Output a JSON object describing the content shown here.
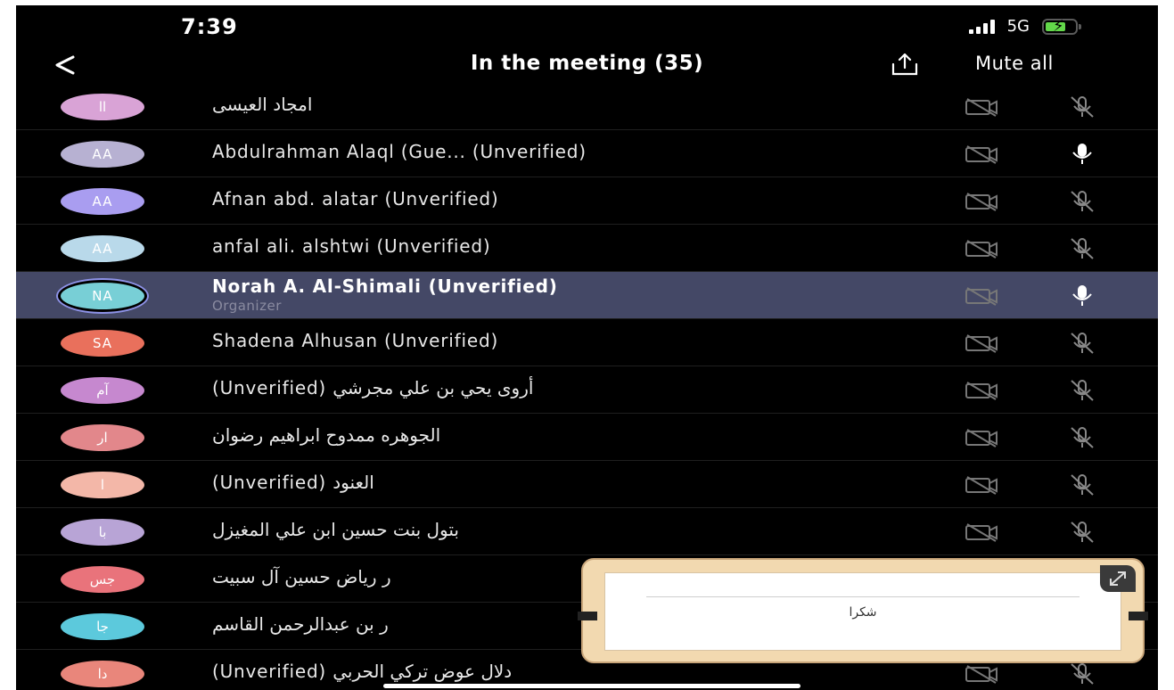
{
  "status": {
    "time": "7:39",
    "network": "5G"
  },
  "header": {
    "title": "In the meeting (35)",
    "mute_all": "Mute all"
  },
  "participants": [
    {
      "initials": "اا",
      "name": "امجاد العيسى",
      "role": "",
      "color": "#d9a3d6",
      "mic": "muted",
      "selected": false
    },
    {
      "initials": "AA",
      "name": "Abdulrahman Alaql (Gue... (Unverified)",
      "role": "",
      "color": "#b7b1d2",
      "mic": "on",
      "selected": false
    },
    {
      "initials": "AA",
      "name": "Afnan abd. alatar (Unverified)",
      "role": "",
      "color": "#a99df0",
      "mic": "muted",
      "selected": false
    },
    {
      "initials": "AA",
      "name": "anfal ali. alshtwi (Unverified)",
      "role": "",
      "color": "#b9d9ea",
      "mic": "muted",
      "selected": false
    },
    {
      "initials": "NA",
      "name": "Norah A. Al-Shimali (Unverified)",
      "role": "Organizer",
      "color": "#78cfd6",
      "mic": "on",
      "selected": true
    },
    {
      "initials": "SA",
      "name": "Shadena Alhusan (Unverified)",
      "role": "",
      "color": "#e9705c",
      "mic": "muted",
      "selected": false
    },
    {
      "initials": "آم",
      "name": "(Unverified) أروى يحي بن علي مجرشي",
      "role": "",
      "color": "#c688cf",
      "mic": "muted",
      "selected": false
    },
    {
      "initials": "ار",
      "name": "الجوهره ممدوح ابراهيم رضوان",
      "role": "",
      "color": "#e2878b",
      "mic": "muted",
      "selected": false
    },
    {
      "initials": "ا",
      "name": "(Unverified) العنود",
      "role": "",
      "color": "#f3b7a8",
      "mic": "muted",
      "selected": false
    },
    {
      "initials": "با",
      "name": "بتول بنت حسين ابن علي المغيزل",
      "role": "",
      "color": "#b8a4d6",
      "mic": "muted",
      "selected": false
    },
    {
      "initials": "جس",
      "name": "ر رياض حسين آل سبيت",
      "role": "",
      "color": "#e9737b",
      "mic": "muted",
      "selected": false
    },
    {
      "initials": "جا",
      "name": "ر بن عبدالرحمن القاسم",
      "role": "",
      "color": "#5cc9dc",
      "mic": "muted",
      "selected": false
    },
    {
      "initials": "دا",
      "name": "(Unverified) دلال عوض تركي الحربي",
      "role": "",
      "color": "#e9867b",
      "mic": "muted",
      "selected": false
    }
  ],
  "overlay": {
    "text": "شكرا"
  }
}
